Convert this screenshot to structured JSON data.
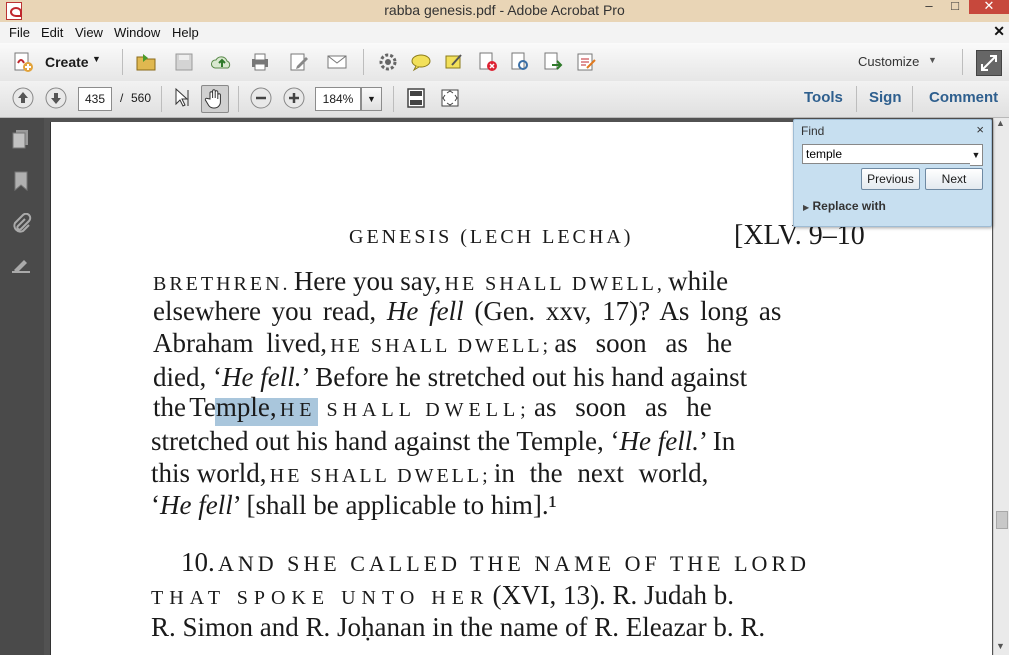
{
  "window": {
    "title": "rabba genesis.pdf - Adobe Acrobat Pro"
  },
  "menu": [
    "File",
    "Edit",
    "View",
    "Window",
    "Help"
  ],
  "toolbar": {
    "create_label": "Create",
    "customize_label": "Customize"
  },
  "nav": {
    "page_current": "435",
    "page_separator": "/",
    "page_total": "560",
    "zoom": "184%"
  },
  "right_links": {
    "tools": "Tools",
    "sign": "Sign",
    "comment": "Comment"
  },
  "find": {
    "title": "Find",
    "value": "temple",
    "previous_label": "Previous",
    "next_label": "Next",
    "replace_label": "Replace with"
  },
  "document": {
    "header_left": "GENESIS (LECH LECHA)",
    "header_right": "[XLV. 9–10",
    "l1a": "BRETHREN.",
    "l1b": "Here you say,",
    "l1c": "HE SHALL DWELL,",
    "l1d": "while",
    "l2a": "elsewhere you read,",
    "l2b": "He fell",
    "l2c": "(Gen. xxv, 17)? As long as",
    "l3a": "Abraham lived,",
    "l3b": "HE SHALL DWELL;",
    "l3c": "as soon as he",
    "l4a": "died, ‘",
    "l4b": "He fell.",
    "l4c": "’ Before he stretched out his hand against",
    "l5a": "the",
    "l5b": "Temple,",
    "l5c": "HE SHALL DWELL;",
    "l5d": "as soon as he",
    "l6a": "stretched out his hand against the Temple, ‘",
    "l6b": "He fell.",
    "l6c": "’ In",
    "l7a": "this world,",
    "l7b": "HE SHALL DWELL;",
    "l7c": "in the next world,",
    "l8a": "‘",
    "l8b": "He fell",
    "l8c": "’ [shall be applicable to him].¹",
    "l9a": "10.",
    "l9b": "AND SHE CALLED THE NAME OF THE LORD",
    "l10a": "THAT SPOKE UNTO HER",
    "l10b": "(XVI, 13). R. Judah b.",
    "l11": "R. Simon and R. Joḥanan in the name of R. Eleazar b. R."
  },
  "colors": {
    "highlight": "#a9c6dc",
    "link": "#2e5f8e",
    "find_panel": "#c7dff0"
  }
}
